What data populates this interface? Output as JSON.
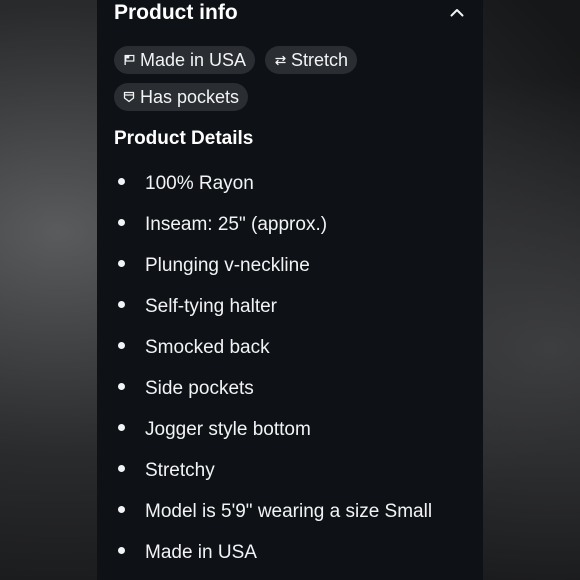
{
  "product_info": {
    "title": "Product info",
    "chips": [
      {
        "label": "Made in USA",
        "icon": "flag-icon"
      },
      {
        "label": "Stretch",
        "icon": "stretch-icon"
      },
      {
        "label": "Has pockets",
        "icon": "pocket-icon"
      }
    ]
  },
  "product_details": {
    "title": "Product Details",
    "items": [
      "100% Rayon",
      "Inseam: 25\" (approx.)",
      "Plunging v-neckline",
      "Self-tying halter",
      "Smocked back",
      "Side pockets",
      "Jogger style bottom",
      "Stretchy",
      "Model is 5'9\" wearing a size Small",
      "Made in USA"
    ]
  },
  "colors": {
    "panel_background": "#0e1216",
    "chip_background": "#2a2d31",
    "text": "#f2f3f5"
  }
}
